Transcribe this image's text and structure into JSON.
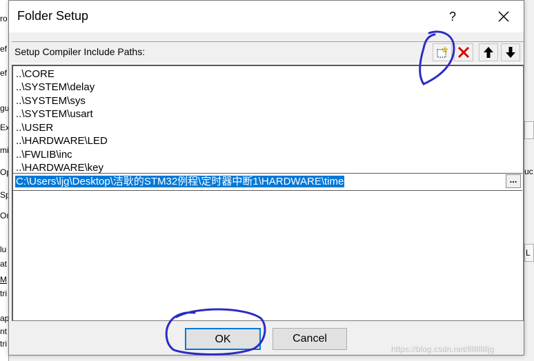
{
  "dialog": {
    "title": "Folder Setup",
    "help_label": "?",
    "close_icon": "close-icon",
    "paths_label": "Setup Compiler Include Paths:",
    "toolbar": {
      "new_icon": "new-folder-icon",
      "delete_icon": "delete-x-icon",
      "up_icon": "arrow-up-icon",
      "down_icon": "arrow-down-icon",
      "delete_color": "#d40000"
    },
    "paths": [
      "..\\CORE",
      "..\\SYSTEM\\delay",
      "..\\SYSTEM\\sys",
      "..\\SYSTEM\\usart",
      "..\\USER",
      "..\\HARDWARE\\LED",
      "..\\FWLIB\\inc",
      "..\\HARDWARE\\key"
    ],
    "edit_value": "C:\\Users\\ljg\\Desktop\\洁耿的STM32例程\\定时器中断1\\HARDWARE\\time",
    "browse_label": "...",
    "ok_label": "OK",
    "cancel_label": "Cancel",
    "selection_color": "#0078d7",
    "annotation_color": "#2b2bc4"
  },
  "background": {
    "left_fragments": [
      "ro",
      "ef",
      "ef",
      "gu",
      "Ex",
      "mi",
      "Op",
      "Sp",
      "On",
      "lu",
      "at",
      "M",
      "tri",
      "ap",
      "nt",
      "tri"
    ],
    "right_fragments": [
      "uc",
      "L"
    ]
  },
  "watermark": "https://blog.csdn.net/llllllllllljg"
}
